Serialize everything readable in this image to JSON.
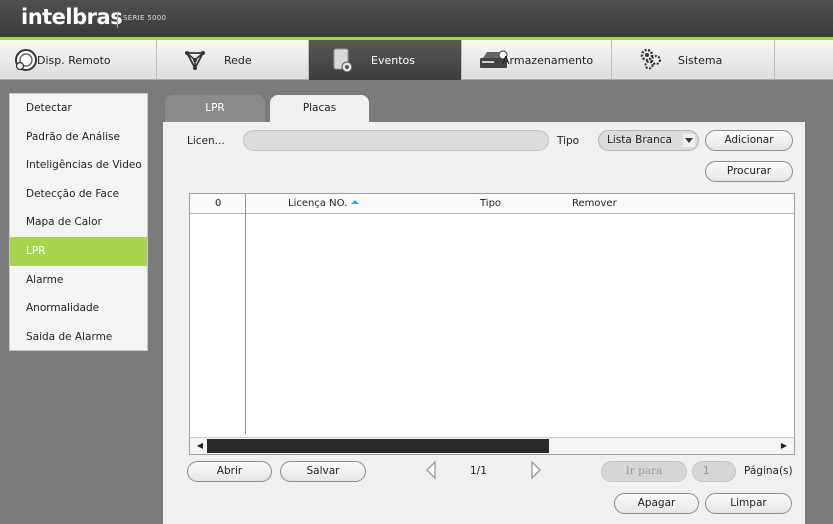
{
  "brand": {
    "name": "intelbras",
    "series": "SÉRIE 5000"
  },
  "nav": [
    {
      "label": "Disp. Remoto",
      "icon": "remote-device-icon"
    },
    {
      "label": "Rede",
      "icon": "network-icon"
    },
    {
      "label": "Eventos",
      "icon": "events-icon",
      "active": true
    },
    {
      "label": "Armazenamento",
      "icon": "storage-icon"
    },
    {
      "label": "Sistema",
      "icon": "system-gears-icon"
    }
  ],
  "sidebar": {
    "items": [
      {
        "label": "Detectar"
      },
      {
        "label": "Padrão de Análise"
      },
      {
        "label": "Inteligências de Video"
      },
      {
        "label": "Detecção de Face"
      },
      {
        "label": "Mapa de Calor"
      },
      {
        "label": "LPR",
        "active": true
      },
      {
        "label": "Alarme"
      },
      {
        "label": "Anormalidade"
      },
      {
        "label": "Saida de Alarme"
      }
    ]
  },
  "tabs": [
    {
      "label": "LPR"
    },
    {
      "label": "Placas",
      "active": true
    }
  ],
  "form": {
    "license_label": "Licen...",
    "license_value": "",
    "type_label": "Tipo",
    "type_value": "Lista Branca",
    "add_button": "Adicionar",
    "search_button": "Procurar"
  },
  "table": {
    "headers": {
      "count": "0",
      "license": "Licença NO.",
      "type": "Tipo",
      "remove": "Remover"
    },
    "rows": []
  },
  "footer": {
    "open_button": "Abrir",
    "save_button": "Salvar",
    "page_indicator": "1/1",
    "goto_button": "Ir para",
    "page_input": "1",
    "page_label": "Página(s)",
    "delete_button": "Apagar",
    "clear_button": "Limpar"
  },
  "colors": {
    "accent_green": "#a7d54d",
    "header_dark": "#3c3c3c",
    "background": "#7b7b7b"
  }
}
